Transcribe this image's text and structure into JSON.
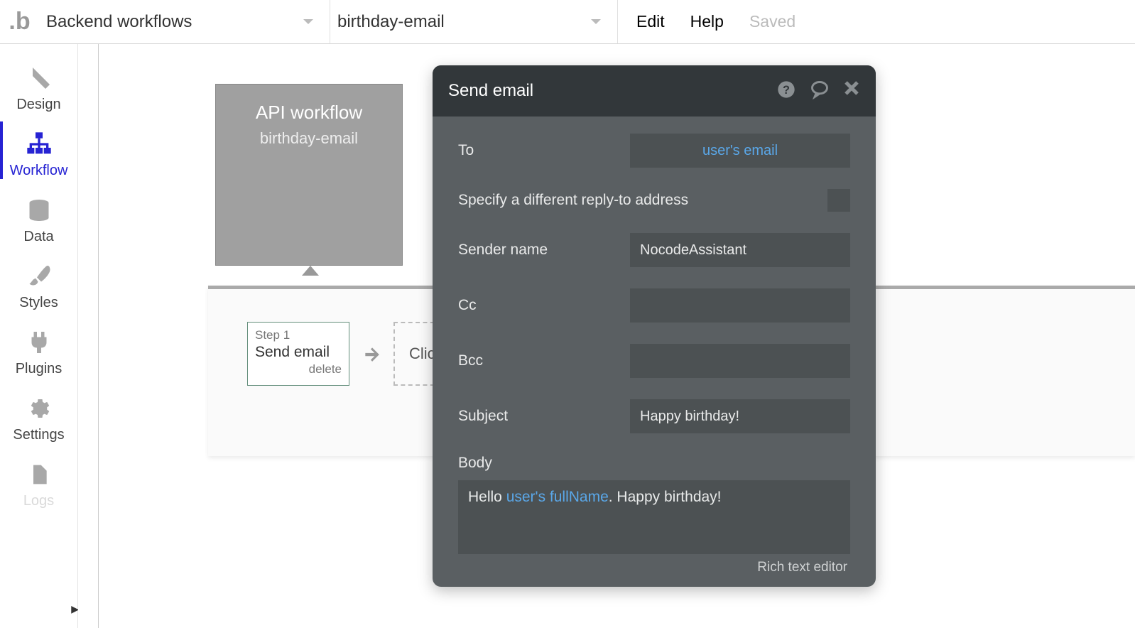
{
  "logo_char": ".b",
  "top": {
    "selector1": "Backend workflows",
    "selector2": "birthday-email",
    "menu": {
      "edit": "Edit",
      "help": "Help",
      "saved": "Saved"
    }
  },
  "sidebar": {
    "design": "Design",
    "workflow": "Workflow",
    "data": "Data",
    "styles": "Styles",
    "plugins": "Plugins",
    "settings": "Settings",
    "logs": "Logs"
  },
  "workflow_card": {
    "title": "API workflow",
    "sub": "birthday-email"
  },
  "steps": {
    "step1_num": "Step 1",
    "step1_title": "Send email",
    "step1_delete": "delete",
    "add_label": "Clic"
  },
  "panel": {
    "title": "Send email",
    "to_label": "To",
    "to_value": "user's email",
    "reply_label": "Specify a different reply-to address",
    "sender_label": "Sender name",
    "sender_value": "NocodeAssistant",
    "cc_label": "Cc",
    "cc_value": "",
    "bcc_label": "Bcc",
    "bcc_value": "",
    "subject_label": "Subject",
    "subject_value": "Happy birthday!",
    "body_label": "Body",
    "body_prefix": "Hello ",
    "body_dyn": "user's fullName",
    "body_suffix": ". Happy birthday!",
    "rte": "Rich text editor"
  }
}
